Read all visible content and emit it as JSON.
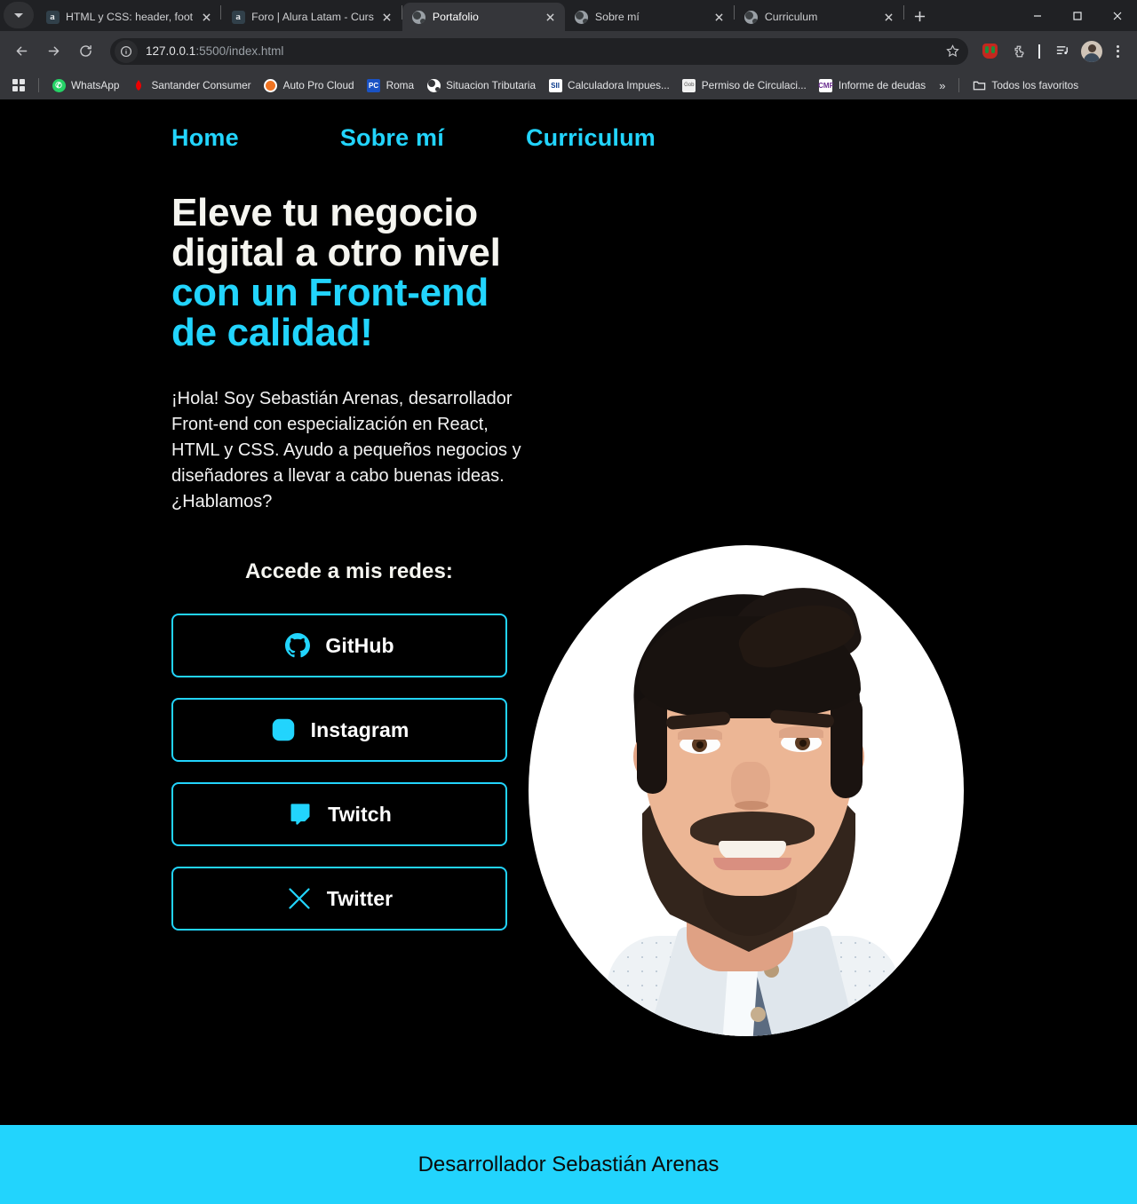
{
  "browser": {
    "tabs": [
      {
        "title": "HTML y CSS: header, foot",
        "favicon": "amazon-icon",
        "active": false
      },
      {
        "title": "Foro | Alura Latam - Curs",
        "favicon": "amazon-icon",
        "active": false
      },
      {
        "title": "Portafolio",
        "favicon": "globe-icon",
        "active": true
      },
      {
        "title": "Sobre mí",
        "favicon": "globe-icon",
        "active": false
      },
      {
        "title": "Curriculum",
        "favicon": "globe-icon",
        "active": false
      }
    ],
    "new_tab_label": "+",
    "window_controls": {
      "minimize": "minimize-icon",
      "maximize": "maximize-icon",
      "close": "close-icon"
    },
    "toolbar": {
      "back": "back-arrow-icon",
      "forward": "forward-arrow-icon",
      "reload": "reload-icon",
      "site_info": "info-icon",
      "url_host": "127.0.0.1",
      "url_path": ":5500/index.html",
      "bookmark_star": "star-icon",
      "extension_1": "extension-red-icon",
      "extension_puzzle": "puzzle-icon",
      "media_list": "media-list-icon",
      "profile": "profile-avatar",
      "menu": "kebab-menu-icon"
    },
    "bookmarks": {
      "apps_label": "apps-grid-icon",
      "items": [
        {
          "label": "WhatsApp",
          "icon": "whatsapp-icon"
        },
        {
          "label": "Santander Consumer",
          "icon": "santander-icon"
        },
        {
          "label": "Auto Pro Cloud",
          "icon": "autopro-icon"
        },
        {
          "label": "Roma",
          "icon": "roma-icon"
        },
        {
          "label": "Situacion Tributaria",
          "icon": "globe-icon"
        },
        {
          "label": "Calculadora Impues...",
          "icon": "sii-icon"
        },
        {
          "label": "Permiso de Circulaci...",
          "icon": "gray-doc-icon"
        },
        {
          "label": "Informe de deudas",
          "icon": "cmf-icon"
        }
      ],
      "overflow": "»",
      "all_bookmarks": "Todos los favoritos"
    }
  },
  "page": {
    "nav": [
      {
        "label": "Home"
      },
      {
        "label": "Sobre mí"
      },
      {
        "label": "Curriculum"
      }
    ],
    "hero": {
      "title_plain": "Eleve tu negocio digital a otro nivel ",
      "title_accent": "con un Front-end de calidad!",
      "paragraph": "¡Hola! Soy Sebastián Arenas, desarrollador Front-end con especialización en React, HTML y CSS. Ayudo a pequeños negocios y diseñadores a llevar a cabo buenas ideas. ¿Hablamos?",
      "portrait_alt": "Retrato de Sebastián Arenas"
    },
    "social": {
      "heading": "Accede a mis redes:",
      "buttons": [
        {
          "label": "GitHub",
          "icon": "github-icon"
        },
        {
          "label": "Instagram",
          "icon": "instagram-icon"
        },
        {
          "label": "Twitch",
          "icon": "twitch-icon"
        },
        {
          "label": "Twitter",
          "icon": "twitter-x-icon"
        }
      ]
    },
    "footer": {
      "text": "Desarrollador Sebastián Arenas"
    },
    "colors": {
      "accent": "#22d4fd",
      "background": "#000000",
      "text": "#f5f5f0"
    }
  }
}
